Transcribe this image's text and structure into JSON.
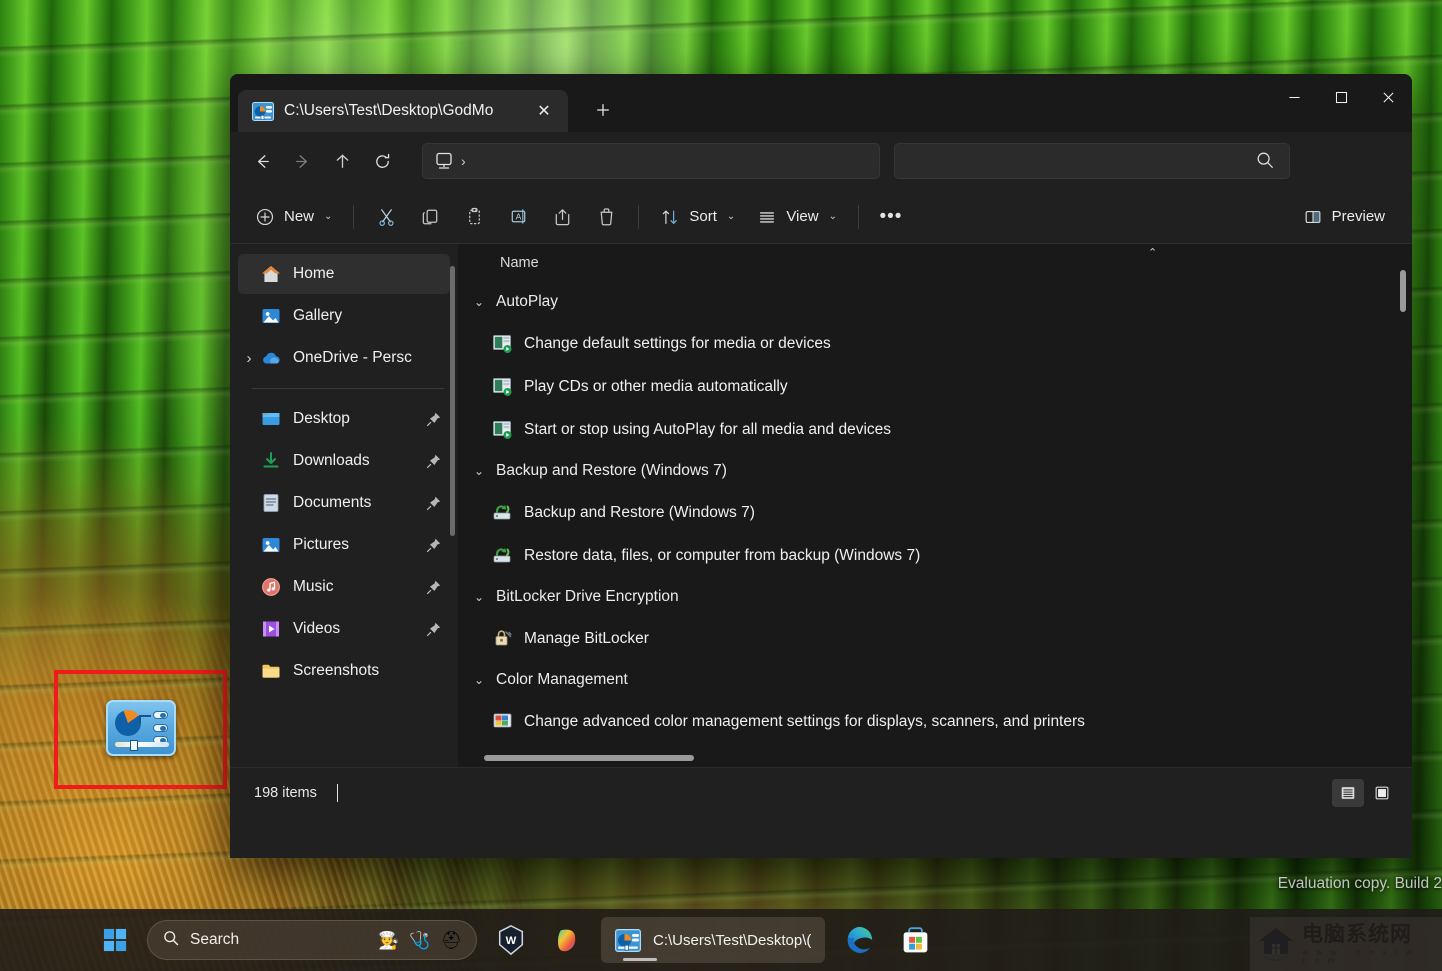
{
  "window": {
    "tab_title": "C:\\Users\\Test\\Desktop\\GodMo",
    "tab_icon": "control-panel-icon",
    "close_tab_icon": "✕",
    "new_tab_icon": "＋",
    "controls": {
      "minimize": "—",
      "maximize": "☐",
      "close": "✕"
    }
  },
  "addressbar": {
    "back_icon": "←",
    "forward_icon": "→",
    "up_icon": "↑",
    "refresh_icon": "⟳",
    "breadcrumb_device_icon": "monitor-icon",
    "breadcrumb_chevron": "›",
    "breadcrumb_path": "",
    "search_placeholder": "",
    "search_value": "",
    "search_icon": "search-icon"
  },
  "toolbar": {
    "new_label": "New",
    "new_icon": "plus-circle-icon",
    "cut_icon": "scissors-icon",
    "copy_icon": "copy-icon",
    "paste_icon": "paste-icon",
    "rename_icon": "rename-icon",
    "share_icon": "share-icon",
    "delete_icon": "trash-icon",
    "sort_label": "Sort",
    "sort_icon": "sort-arrows-icon",
    "view_label": "View",
    "view_icon": "list-lines-icon",
    "more_icon": "•••",
    "preview_label": "Preview",
    "preview_icon": "preview-pane-icon",
    "chevron": "⌄"
  },
  "sidebar": {
    "top_items": [
      {
        "label": "Home",
        "icon": "home-icon",
        "selected": true,
        "pinned": false,
        "expandable": false
      },
      {
        "label": "Gallery",
        "icon": "gallery-icon",
        "selected": false,
        "pinned": false,
        "expandable": false
      },
      {
        "label": "OneDrive - Persc",
        "icon": "onedrive-cloud-icon",
        "selected": false,
        "pinned": false,
        "expandable": true
      }
    ],
    "pinned_items": [
      {
        "label": "Desktop",
        "icon": "desktop-icon",
        "pinned": true
      },
      {
        "label": "Downloads",
        "icon": "downloads-icon",
        "pinned": true
      },
      {
        "label": "Documents",
        "icon": "documents-icon",
        "pinned": true
      },
      {
        "label": "Pictures",
        "icon": "pictures-icon",
        "pinned": true
      },
      {
        "label": "Music",
        "icon": "music-icon",
        "pinned": true
      },
      {
        "label": "Videos",
        "icon": "videos-icon",
        "pinned": true
      },
      {
        "label": "Screenshots",
        "icon": "folder-icon",
        "pinned": false
      }
    ],
    "expander_icon": "›",
    "pin_icon": "pin-icon"
  },
  "content": {
    "column_header": "Name",
    "sort_caret": "⌃",
    "group_chevron": "⌄",
    "groups": [
      {
        "name": "AutoPlay",
        "items": [
          {
            "label": "Change default settings for media or devices",
            "icon": "autoplay-icon"
          },
          {
            "label": "Play CDs or other media automatically",
            "icon": "autoplay-icon"
          },
          {
            "label": "Start or stop using AutoPlay for all media and devices",
            "icon": "autoplay-icon"
          }
        ]
      },
      {
        "name": "Backup and Restore (Windows 7)",
        "items": [
          {
            "label": "Backup and Restore (Windows 7)",
            "icon": "backup-icon"
          },
          {
            "label": "Restore data, files, or computer from backup (Windows 7)",
            "icon": "backup-icon"
          }
        ]
      },
      {
        "name": "BitLocker Drive Encryption",
        "items": [
          {
            "label": "Manage BitLocker",
            "icon": "bitlocker-key-icon"
          }
        ]
      },
      {
        "name": "Color Management",
        "items": [
          {
            "label": "Change advanced color management settings for displays, scanners, and printers",
            "icon": "color-management-icon"
          }
        ]
      }
    ]
  },
  "status": {
    "item_count": "198 items",
    "details_view_icon": "details-view-icon",
    "large_icons_view_icon": "large-icons-view-icon"
  },
  "desktop": {
    "godmode_icon_name": "godmode-control-panel-icon",
    "annotation_color": "#f01c1c",
    "eval_watermark": "Evaluation copy. Build 2",
    "site_watermark_cn": "电脑系统网",
    "site_watermark_url": "w w w . d n x t w . c o m"
  },
  "taskbar": {
    "start_icon": "windows-start-icon",
    "search_placeholder": "Search",
    "search_icon": "search-icon",
    "search_emojis": [
      "🧑‍🍳",
      "🩺",
      "⛑"
    ],
    "apps": [
      {
        "name": "wiki-w-icon",
        "label": ""
      },
      {
        "name": "copilot-icon",
        "label": ""
      }
    ],
    "active_app_label": "C:\\Users\\Test\\Desktop\\(",
    "active_app_icon": "control-panel-icon",
    "edge_icon": "edge-browser-icon",
    "store_icon": "microsoft-store-icon"
  },
  "colors": {
    "accent": "#4cc2ff",
    "window_bg": "#202020",
    "content_bg": "#191919",
    "annotation": "#f01c1c"
  }
}
